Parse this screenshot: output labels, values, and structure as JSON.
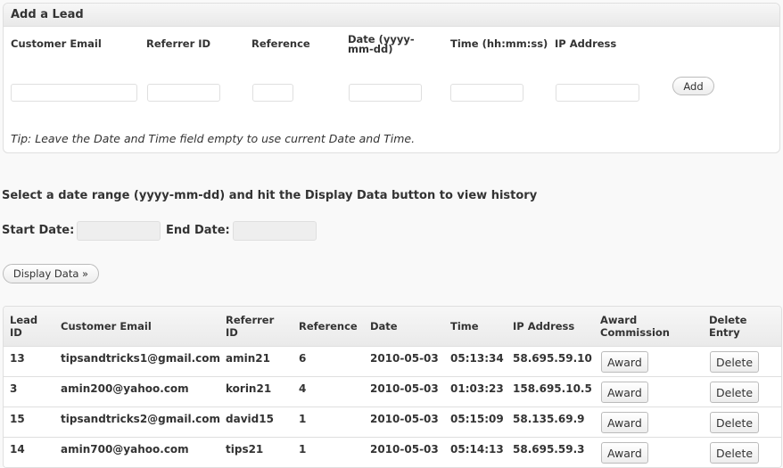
{
  "add_lead": {
    "title": "Add a Lead",
    "fields": {
      "customer_email": {
        "label": "Customer Email",
        "value": ""
      },
      "referrer_id": {
        "label": "Referrer ID",
        "value": ""
      },
      "reference": {
        "label": "Reference",
        "value": ""
      },
      "date": {
        "label": "Date (yyyy-mm-dd)",
        "value": ""
      },
      "time": {
        "label": "Time (hh:mm:ss)",
        "value": ""
      },
      "ip_address": {
        "label": "IP Address",
        "value": ""
      }
    },
    "add_label": "Add",
    "tip": "Tip: Leave the Date and Time field empty to use current Date and Time."
  },
  "history": {
    "title": "Select a date range (yyyy-mm-dd) and hit the Display Data button to view history",
    "start_label": "Start Date:",
    "start_value": "",
    "end_label": "End Date:",
    "end_value": "",
    "display_label": "Display Data »"
  },
  "table": {
    "headers": {
      "lead_id": "Lead ID",
      "email": "Customer Email",
      "referrer": "Referrer ID",
      "reference": "Reference",
      "date": "Date",
      "time": "Time",
      "ip": "IP Address",
      "award": "Award Commission",
      "delete": "Delete Entry"
    },
    "rows": [
      {
        "lead_id": "13",
        "email": "tipsandtricks1@gmail.com",
        "referrer": "amin21",
        "reference": "6",
        "date": "2010-05-03",
        "time": "05:13:34",
        "ip": "58.695.59.10",
        "award": "Award",
        "delete": "Delete"
      },
      {
        "lead_id": "3",
        "email": "amin200@yahoo.com",
        "referrer": "korin21",
        "reference": "4",
        "date": "2010-05-03",
        "time": "01:03:23",
        "ip": "158.695.10.5",
        "award": "Award",
        "delete": "Delete"
      },
      {
        "lead_id": "15",
        "email": "tipsandtricks2@gmail.com",
        "referrer": "david15",
        "reference": "1",
        "date": "2010-05-03",
        "time": "05:15:09",
        "ip": "58.135.69.9",
        "award": "Award",
        "delete": "Delete"
      },
      {
        "lead_id": "14",
        "email": "amin700@yahoo.com",
        "referrer": "tips21",
        "reference": "1",
        "date": "2010-05-03",
        "time": "05:14:13",
        "ip": "58.695.59.3",
        "award": "Award",
        "delete": "Delete"
      }
    ]
  }
}
